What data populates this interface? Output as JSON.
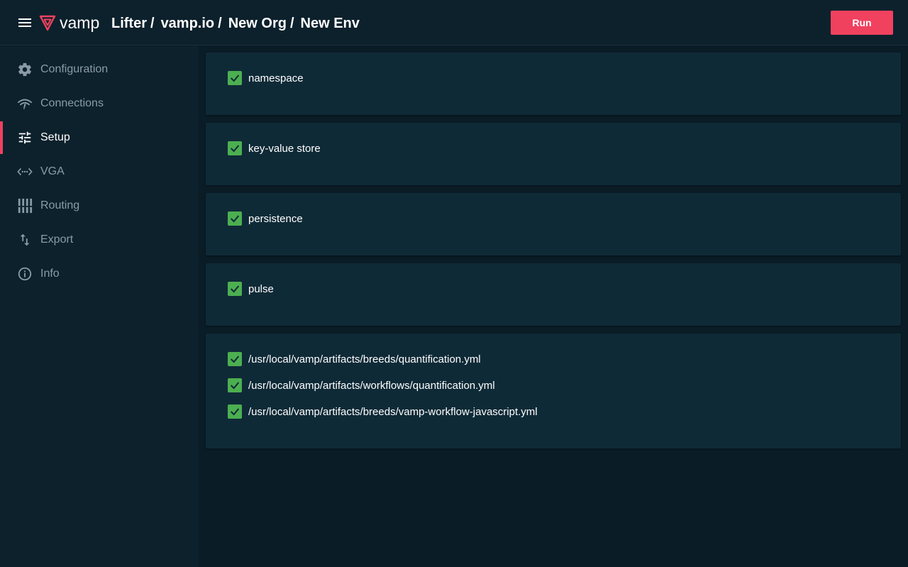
{
  "header": {
    "logo_text": "vamp",
    "breadcrumbs": [
      "Lifter",
      "vamp.io",
      "New Org",
      "New Env"
    ],
    "separator": "/",
    "run_label": "Run",
    "accent_color": "#f0415f"
  },
  "sidebar": {
    "items": [
      {
        "label": "Configuration",
        "icon": "gear-icon",
        "active": false
      },
      {
        "label": "Connections",
        "icon": "wifi-icon",
        "active": false
      },
      {
        "label": "Setup",
        "icon": "sliders-icon",
        "active": true
      },
      {
        "label": "VGA",
        "icon": "code-dots-icon",
        "active": false
      },
      {
        "label": "Routing",
        "icon": "equalizer-icon",
        "active": false
      },
      {
        "label": "Export",
        "icon": "swap-vertical-icon",
        "active": false
      },
      {
        "label": "Info",
        "icon": "info-icon",
        "active": false
      }
    ]
  },
  "cards": [
    {
      "items": [
        {
          "label": "namespace",
          "checked": true
        }
      ]
    },
    {
      "items": [
        {
          "label": "key-value store",
          "checked": true
        }
      ]
    },
    {
      "items": [
        {
          "label": "persistence",
          "checked": true
        }
      ]
    },
    {
      "items": [
        {
          "label": "pulse",
          "checked": true
        }
      ]
    },
    {
      "items": [
        {
          "label": "/usr/local/vamp/artifacts/breeds/quantification.yml",
          "checked": true
        },
        {
          "label": "/usr/local/vamp/artifacts/workflows/quantification.yml",
          "checked": true
        },
        {
          "label": "/usr/local/vamp/artifacts/breeds/vamp-workflow-javascript.yml",
          "checked": true
        }
      ]
    }
  ],
  "colors": {
    "checkbox": "#4caf50",
    "background": "#0a1c26",
    "card": "#0f2a37"
  }
}
